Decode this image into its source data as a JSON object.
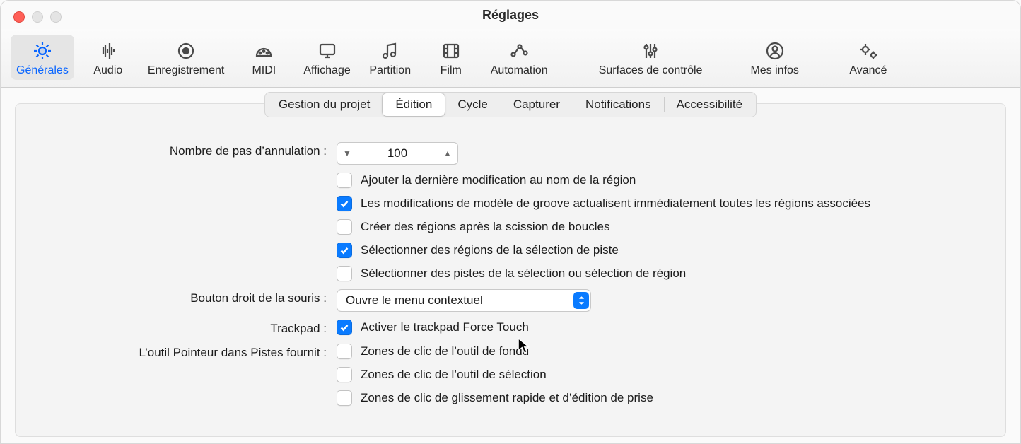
{
  "window": {
    "title": "Réglages"
  },
  "toolbar": {
    "items": [
      {
        "key": "general",
        "label": "Générales",
        "icon": "gear",
        "active": true
      },
      {
        "key": "audio",
        "label": "Audio",
        "icon": "waveform",
        "active": false
      },
      {
        "key": "record",
        "label": "Enregistrement",
        "icon": "record",
        "active": false
      },
      {
        "key": "midi",
        "label": "MIDI",
        "icon": "midi",
        "active": false
      },
      {
        "key": "display",
        "label": "Affichage",
        "icon": "monitor",
        "active": false
      },
      {
        "key": "score",
        "label": "Partition",
        "icon": "notes",
        "active": false
      },
      {
        "key": "film",
        "label": "Film",
        "icon": "film",
        "active": false
      },
      {
        "key": "automtn",
        "label": "Automation",
        "icon": "automation",
        "active": false
      },
      {
        "key": "surfaces",
        "label": "Surfaces de contrôle",
        "icon": "sliders",
        "active": false
      },
      {
        "key": "myinfo",
        "label": "Mes infos",
        "icon": "person",
        "active": false
      },
      {
        "key": "advanced",
        "label": "Avancé",
        "icon": "gears",
        "active": false
      }
    ]
  },
  "tabs": {
    "items": [
      {
        "key": "project",
        "label": "Gestion du projet",
        "active": false
      },
      {
        "key": "edition",
        "label": "Édition",
        "active": true
      },
      {
        "key": "cycle",
        "label": "Cycle",
        "active": false
      },
      {
        "key": "capture",
        "label": "Capturer",
        "active": false
      },
      {
        "key": "notif",
        "label": "Notifications",
        "active": false
      },
      {
        "key": "access",
        "label": "Accessibilité",
        "active": false
      }
    ]
  },
  "form": {
    "undoSteps": {
      "label": "Nombre de pas d’annulation :",
      "value": "100"
    },
    "rightMouse": {
      "label": "Bouton droit de la souris :",
      "value": "Ouvre le menu contextuel"
    },
    "trackpad": {
      "label": "Trackpad :"
    },
    "pointer": {
      "label": "L’outil Pointeur dans Pistes fournit :"
    },
    "checks": {
      "addLastEdit": {
        "checked": false,
        "label": "Ajouter la dernière modification au nom de la région"
      },
      "grooveUpdate": {
        "checked": true,
        "label": "Les modifications de modèle de groove actualisent immédiatement toutes les régions associées"
      },
      "createAfter": {
        "checked": false,
        "label": "Créer des régions après la scission de boucles"
      },
      "selRegions": {
        "checked": true,
        "label": "Sélectionner des régions de la sélection de piste"
      },
      "selTracks": {
        "checked": false,
        "label": "Sélectionner des pistes de la sélection ou sélection de région"
      },
      "forceTouch": {
        "checked": true,
        "label": "Activer le trackpad Force Touch"
      },
      "fadeZones": {
        "checked": false,
        "label": "Zones de clic de l’outil de fondu"
      },
      "selZones": {
        "checked": false,
        "label": "Zones de clic de l’outil de sélection"
      },
      "quickSwipe": {
        "checked": false,
        "label": "Zones de clic de glissement rapide et d’édition de prise"
      }
    }
  },
  "colors": {
    "accent": "#0a7bff"
  }
}
